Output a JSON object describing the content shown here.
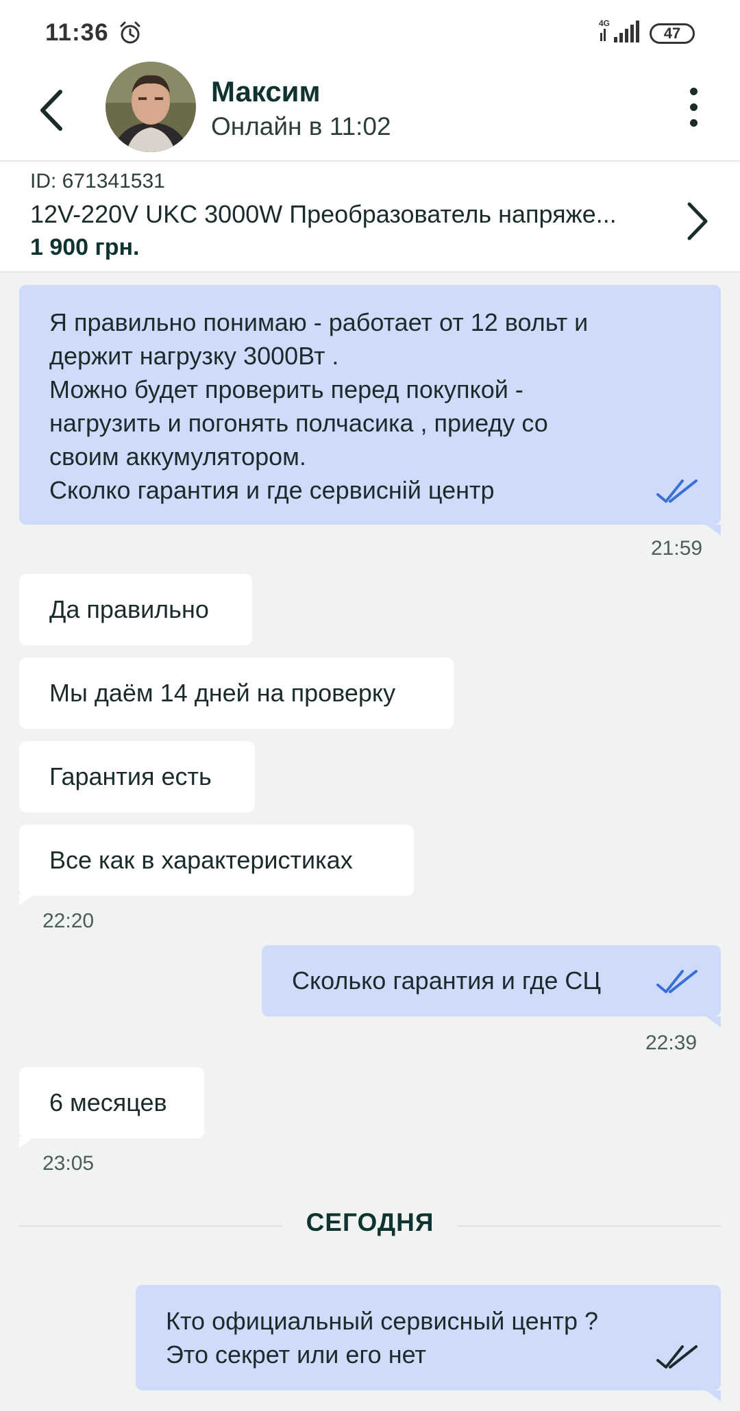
{
  "status_bar": {
    "time": "11:36",
    "network": "4G",
    "battery": "47"
  },
  "header": {
    "name": "Максим",
    "status": "Онлайн в 11:02"
  },
  "product": {
    "id": "ID: 671341531",
    "title": "12V-220V UKC 3000W Преобразователь напряже...",
    "price": "1 900 грн."
  },
  "messages": [
    {
      "direction": "out",
      "lines": [
        "Я правильно понимаю - работает от 12 вольт и",
        "держит нагрузку 3000Вт .",
        "Можно будет проверить перед покупкой -",
        "нагрузить и погонять полчасика , приеду со",
        "своим аккумулятором.",
        "Сколко гарантия и где сервисній центр"
      ],
      "time": "21:59"
    },
    {
      "direction": "in",
      "text": "Да правильно"
    },
    {
      "direction": "in",
      "text": "Мы даём 14 дней на проверку"
    },
    {
      "direction": "in",
      "text": "Гарантия есть"
    },
    {
      "direction": "in",
      "text": "Все как в характеристиках",
      "time": "22:20"
    },
    {
      "direction": "out",
      "text": "Сколько гарантия и где СЦ",
      "time": "22:39"
    },
    {
      "direction": "in",
      "text": "6 месяцев",
      "time": "23:05"
    },
    {
      "direction": "out",
      "lines": [
        "Кто официальный сервисный центр ?",
        "Это секрет или его нет"
      ]
    }
  ],
  "day_separator": "СЕГОДНЯ",
  "colors": {
    "outgoing_bubble": "#cfdbfb",
    "incoming_bubble": "#ffffff",
    "read_ticks": "#3b6fd8",
    "background": "#f1f3f2"
  }
}
